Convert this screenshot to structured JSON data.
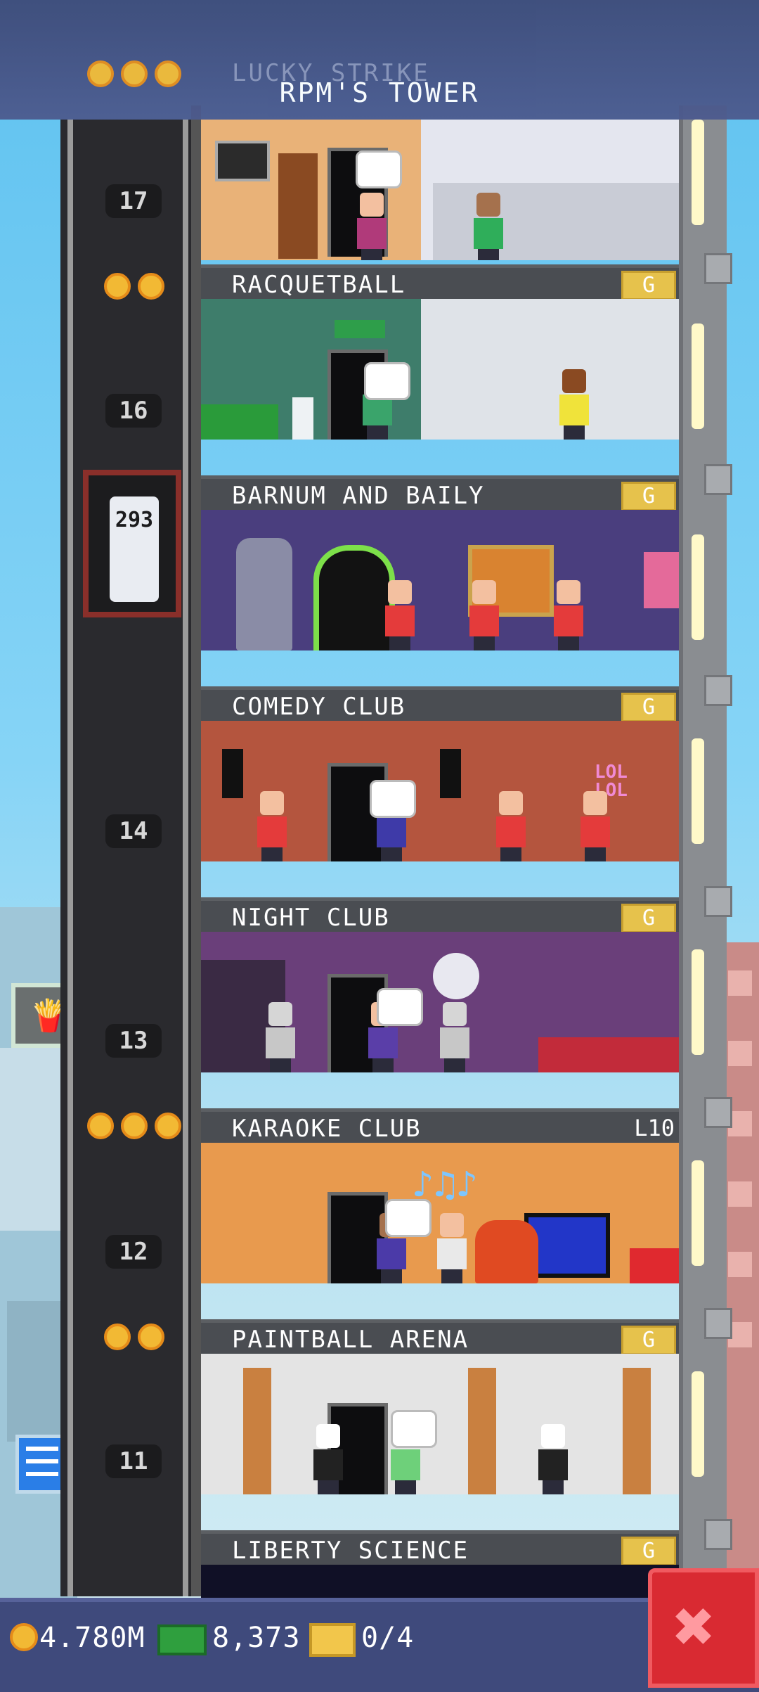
{
  "tower": {
    "name": "RPM'S TOWER",
    "ghost_floor_label": "LUCKY STRIKE"
  },
  "floors": [
    {
      "number": "17",
      "name": "RACQUETBALL",
      "badge": "G"
    },
    {
      "number": "16",
      "name": "BARNUM AND BAILY",
      "badge": "G"
    },
    {
      "number": "",
      "name": "COMEDY CLUB",
      "badge": "G"
    },
    {
      "number": "14",
      "name": "NIGHT CLUB",
      "badge": "G"
    },
    {
      "number": "13",
      "name": "KARAOKE CLUB",
      "level": "L10"
    },
    {
      "number": "12",
      "name": "PAINTBALL ARENA",
      "badge": "G"
    },
    {
      "number": "11",
      "name": "LIBERTY SCIENCE",
      "badge": "G"
    }
  ],
  "elevator": {
    "display": "293"
  },
  "bubbles": {
    "comedy": "LOL",
    "comedy2": "LOL"
  },
  "status_bar": {
    "coins": "4.780M",
    "cash": "8,373",
    "tickets": "0/4"
  },
  "colors": {
    "coin": "#f2b934",
    "close": "#d92a32",
    "hud": "#3f4a7c"
  },
  "icons": {
    "close": "close-icon",
    "coin": "coin-icon",
    "cash": "cash-icon",
    "ticket": "ticket-icon"
  }
}
